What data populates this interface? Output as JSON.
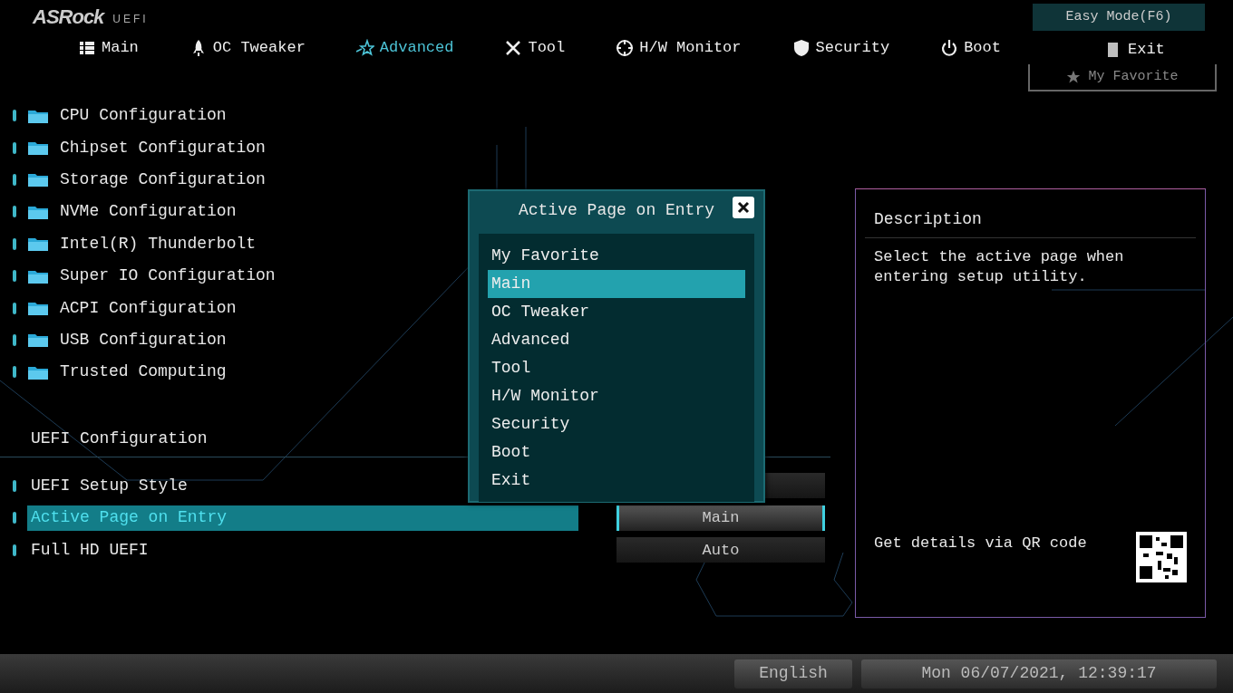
{
  "header": {
    "logo": "ASRock",
    "logo_suffix": "UEFI"
  },
  "tabs": [
    {
      "label": "Main",
      "kind": "main",
      "selected": false
    },
    {
      "label": "OC Tweaker",
      "kind": "rocket",
      "selected": false
    },
    {
      "label": "Advanced",
      "kind": "star",
      "selected": true
    },
    {
      "label": "Tool",
      "kind": "tool",
      "selected": false
    },
    {
      "label": "H/W Monitor",
      "kind": "monitor",
      "selected": false
    },
    {
      "label": "Security",
      "kind": "shield",
      "selected": false
    },
    {
      "label": "Boot",
      "kind": "power",
      "selected": false
    },
    {
      "label": "Exit",
      "kind": "exit",
      "selected": false
    }
  ],
  "easy_mode": "Easy Mode(F6)",
  "favorite": "My Favorite",
  "menu_items": [
    {
      "label": "CPU Configuration"
    },
    {
      "label": "Chipset Configuration"
    },
    {
      "label": "Storage Configuration"
    },
    {
      "label": "NVMe Configuration"
    },
    {
      "label": "Intel(R) Thunderbolt"
    },
    {
      "label": "Super IO Configuration"
    },
    {
      "label": "ACPI Configuration"
    },
    {
      "label": "USB Configuration"
    },
    {
      "label": "Trusted Computing"
    }
  ],
  "section_title": "UEFI Configuration",
  "settings": [
    {
      "label": "UEFI Setup Style",
      "selected": false
    },
    {
      "label": "Active Page on Entry",
      "selected": true,
      "value": "Main"
    },
    {
      "label": "Full HD UEFI",
      "selected": false,
      "value": "Auto"
    }
  ],
  "popup": {
    "title": "Active Page on Entry",
    "options": [
      {
        "label": "My Favorite",
        "selected": false
      },
      {
        "label": "Main",
        "selected": true
      },
      {
        "label": "OC Tweaker",
        "selected": false
      },
      {
        "label": "Advanced",
        "selected": false
      },
      {
        "label": "Tool",
        "selected": false
      },
      {
        "label": "H/W Monitor",
        "selected": false
      },
      {
        "label": "Security",
        "selected": false
      },
      {
        "label": "Boot",
        "selected": false
      },
      {
        "label": "Exit",
        "selected": false
      }
    ]
  },
  "description": {
    "title": "Description",
    "text": "Select the active page when entering setup utility.",
    "qr_caption": "Get details via QR code"
  },
  "status_bar": {
    "language": "English",
    "datetime": "Mon 06/07/2021, 12:39:17"
  }
}
